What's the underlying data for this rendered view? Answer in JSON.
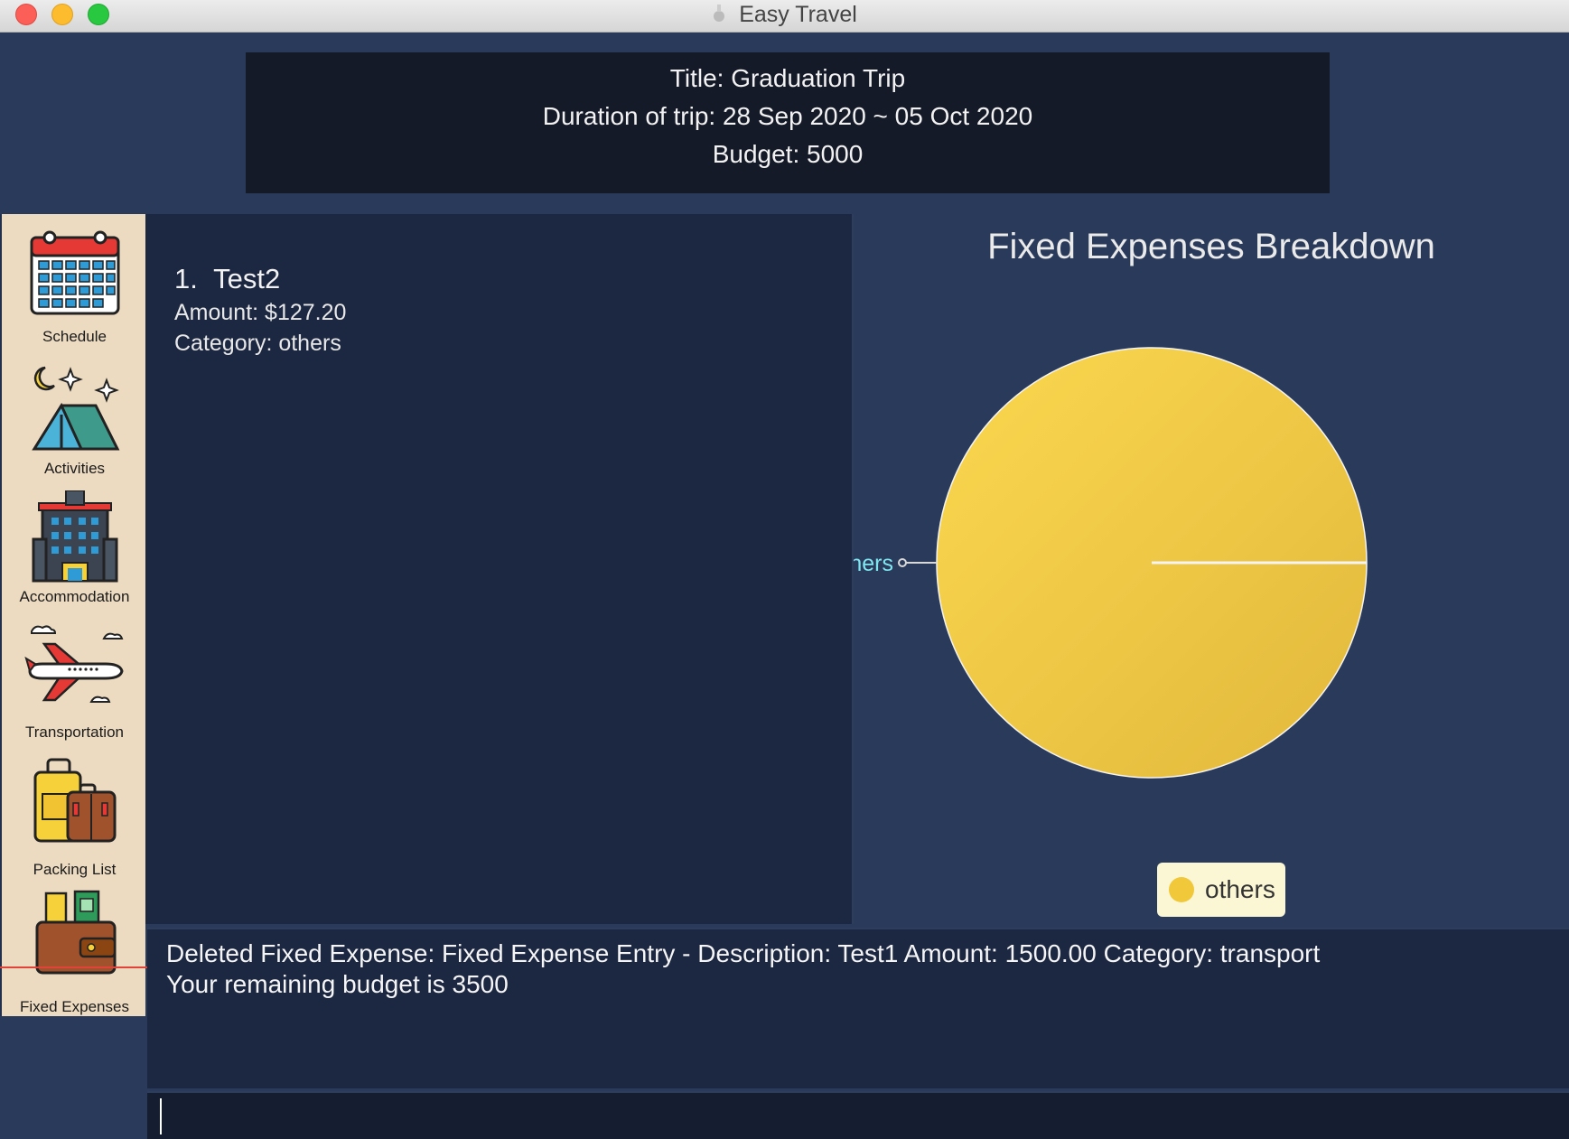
{
  "window": {
    "title": "Easy Travel",
    "icon": "easy-travel-app-icon"
  },
  "trip": {
    "title": "Title: Graduation Trip",
    "duration": "Duration of trip: 28 Sep 2020 ~ 05 Oct 2020",
    "budget": "Budget: 5000"
  },
  "sidebar": {
    "items": [
      {
        "label": "Schedule",
        "icon": "calendar-icon"
      },
      {
        "label": "Activities",
        "icon": "tent-icon"
      },
      {
        "label": "Accommodation",
        "icon": "hotel-icon"
      },
      {
        "label": "Transportation",
        "icon": "airplane-icon"
      },
      {
        "label": "Packing List",
        "icon": "luggage-icon"
      },
      {
        "label": "Fixed Expenses",
        "icon": "wallet-icon"
      }
    ]
  },
  "expenses": {
    "items": [
      {
        "index": "1.",
        "name": "Test2",
        "amount": "Amount: $127.20",
        "category": "Category: others"
      }
    ]
  },
  "chart_data": {
    "type": "pie",
    "title": "Fixed Expenses Breakdown",
    "categories": [
      "others"
    ],
    "values": [
      127.2
    ],
    "slice_labels": [
      "others"
    ],
    "legend": {
      "position": "bottom",
      "entries": [
        "others"
      ]
    },
    "colors": [
      "#f0c83a"
    ]
  },
  "result": {
    "line1": "Deleted Fixed Expense: Fixed Expense Entry - Description: Test1 Amount: 1500.00 Category: transport",
    "line2": "Your remaining budget is 3500"
  },
  "command": {
    "value": "",
    "placeholder": ""
  },
  "colors": {
    "background": "#2a3a5b",
    "panel": "#1c2741",
    "header": "#151a29",
    "sidebar": "#ecdbc0",
    "pie": "#f0c83a",
    "slice_label": "#7fe6f0",
    "arrow": "#e0433a"
  }
}
